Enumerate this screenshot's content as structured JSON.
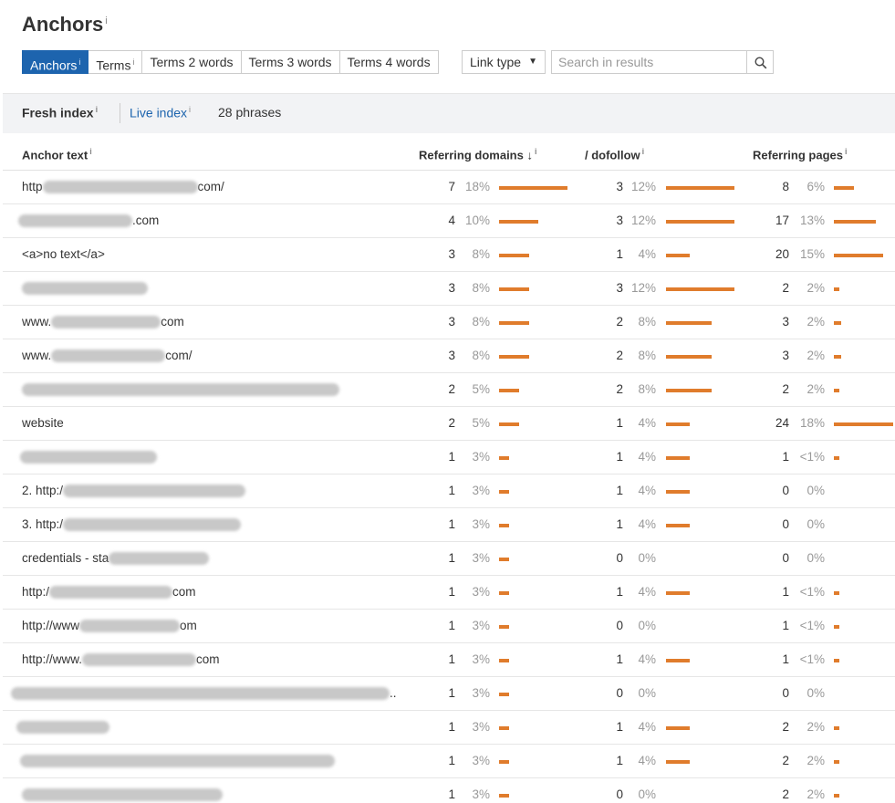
{
  "title": "Anchors",
  "info_glyph": "i",
  "tabs": [
    {
      "label": "Anchors",
      "active": true,
      "info": true
    },
    {
      "label": "Terms",
      "active": false,
      "info": true
    },
    {
      "label": "Terms 2 words",
      "active": false,
      "info": false
    },
    {
      "label": "Terms 3 words",
      "active": false,
      "info": false
    },
    {
      "label": "Terms 4 words",
      "active": false,
      "info": false
    }
  ],
  "link_type": {
    "label": "Link type",
    "caret": "▼"
  },
  "search": {
    "placeholder": "Search in results"
  },
  "index_bar": {
    "fresh": "Fresh index",
    "live": "Live index",
    "phrases": "28 phrases"
  },
  "columns": {
    "anchor": "Anchor text",
    "referring_domains": "Referring domains",
    "sort_arrow": "↓",
    "dofollow": "/ dofollow",
    "referring_pages": "Referring pages"
  },
  "colors": {
    "accent": "#1d64ae",
    "bar": "#e07c2c"
  },
  "rows": [
    {
      "pre": "http",
      "blur": 170,
      "post": "com/",
      "lead": 0,
      "rd": "7",
      "rdp": "18%",
      "rdb": 0.75,
      "df": "3",
      "dfp": "12%",
      "dfb": 0.75,
      "rp": "8",
      "rpp": "6%",
      "rpb": 0.22
    },
    {
      "pre": "",
      "blur": 125,
      "post": ".com",
      "lead": -4,
      "rd": "4",
      "rdp": "10%",
      "rdb": 0.43,
      "df": "3",
      "dfp": "12%",
      "dfb": 0.75,
      "rp": "17",
      "rpp": "13%",
      "rpb": 0.46
    },
    {
      "pre": "<a>no text</a>",
      "blur": 0,
      "post": "",
      "lead": 0,
      "rd": "3",
      "rdp": "8%",
      "rdb": 0.33,
      "df": "1",
      "dfp": "4%",
      "dfb": 0.26,
      "rp": "20",
      "rpp": "15%",
      "rpb": 0.54
    },
    {
      "pre": "",
      "blur": 138,
      "post": "",
      "lead": 0,
      "rd": "3",
      "rdp": "8%",
      "rdb": 0.33,
      "df": "3",
      "dfp": "12%",
      "dfb": 0.75,
      "rp": "2",
      "rpp": "2%",
      "rpb": 0.05
    },
    {
      "pre": "www.",
      "blur": 120,
      "post": "com",
      "lead": 0,
      "rd": "3",
      "rdp": "8%",
      "rdb": 0.33,
      "df": "2",
      "dfp": "8%",
      "dfb": 0.5,
      "rp": "3",
      "rpp": "2%",
      "rpb": 0.08
    },
    {
      "pre": "www.",
      "blur": 125,
      "post": "com/",
      "lead": 0,
      "rd": "3",
      "rdp": "8%",
      "rdb": 0.33,
      "df": "2",
      "dfp": "8%",
      "dfb": 0.5,
      "rp": "3",
      "rpp": "2%",
      "rpb": 0.08
    },
    {
      "pre": "",
      "blur": 348,
      "post": "",
      "lead": 0,
      "rd": "2",
      "rdp": "5%",
      "rdb": 0.22,
      "df": "2",
      "dfp": "8%",
      "dfb": 0.5,
      "rp": "2",
      "rpp": "2%",
      "rpb": 0.05
    },
    {
      "pre": "website",
      "blur": 0,
      "post": "",
      "lead": 0,
      "rd": "2",
      "rdp": "5%",
      "rdb": 0.22,
      "df": "1",
      "dfp": "4%",
      "dfb": 0.26,
      "rp": "24",
      "rpp": "18%",
      "rpb": 0.65
    },
    {
      "pre": "",
      "blur": 150,
      "post": "",
      "lead": -2,
      "rd": "1",
      "rdp": "3%",
      "rdb": 0.11,
      "df": "1",
      "dfp": "4%",
      "dfb": 0.26,
      "rp": "1",
      "rpp": "<1%",
      "rpb": 0.04
    },
    {
      "pre": "2. http:/",
      "blur": 200,
      "post": "",
      "lead": 0,
      "rd": "1",
      "rdp": "3%",
      "rdb": 0.11,
      "df": "1",
      "dfp": "4%",
      "dfb": 0.26,
      "rp": "0",
      "rpp": "0%",
      "rpb": 0
    },
    {
      "pre": "3. http:/",
      "blur": 195,
      "post": "",
      "lead": 0,
      "rd": "1",
      "rdp": "3%",
      "rdb": 0.11,
      "df": "1",
      "dfp": "4%",
      "dfb": 0.26,
      "rp": "0",
      "rpp": "0%",
      "rpb": 0
    },
    {
      "pre": "credentials - sta",
      "blur": 110,
      "post": "",
      "lead": 0,
      "rd": "1",
      "rdp": "3%",
      "rdb": 0.11,
      "df": "0",
      "dfp": "0%",
      "dfb": 0,
      "rp": "0",
      "rpp": "0%",
      "rpb": 0
    },
    {
      "pre": "http:/",
      "blur": 135,
      "post": "com",
      "lead": 0,
      "rd": "1",
      "rdp": "3%",
      "rdb": 0.11,
      "df": "1",
      "dfp": "4%",
      "dfb": 0.26,
      "rp": "1",
      "rpp": "<1%",
      "rpb": 0.04
    },
    {
      "pre": "http://www",
      "blur": 110,
      "post": "om",
      "lead": 0,
      "rd": "1",
      "rdp": "3%",
      "rdb": 0.11,
      "df": "0",
      "dfp": "0%",
      "dfb": 0,
      "rp": "1",
      "rpp": "<1%",
      "rpb": 0.04
    },
    {
      "pre": "http://www.",
      "blur": 125,
      "post": "com",
      "lead": 0,
      "rd": "1",
      "rdp": "3%",
      "rdb": 0.11,
      "df": "1",
      "dfp": "4%",
      "dfb": 0.26,
      "rp": "1",
      "rpp": "<1%",
      "rpb": 0.04
    },
    {
      "pre": "",
      "blur": 415,
      "post": "..",
      "lead": -12,
      "rd": "1",
      "rdp": "3%",
      "rdb": 0.11,
      "df": "0",
      "dfp": "0%",
      "dfb": 0,
      "rp": "0",
      "rpp": "0%",
      "rpb": 0
    },
    {
      "pre": "",
      "blur": 102,
      "post": "",
      "lead": -6,
      "rd": "1",
      "rdp": "3%",
      "rdb": 0.11,
      "df": "1",
      "dfp": "4%",
      "dfb": 0.26,
      "rp": "2",
      "rpp": "2%",
      "rpb": 0.05
    },
    {
      "pre": "",
      "blur": 345,
      "post": "",
      "lead": -2,
      "rd": "1",
      "rdp": "3%",
      "rdb": 0.11,
      "df": "1",
      "dfp": "4%",
      "dfb": 0.26,
      "rp": "2",
      "rpp": "2%",
      "rpb": 0.05
    },
    {
      "pre": "",
      "blur": 220,
      "post": "",
      "lead": 0,
      "rd": "1",
      "rdp": "3%",
      "rdb": 0.11,
      "df": "0",
      "dfp": "0%",
      "dfb": 0,
      "rp": "2",
      "rpp": "2%",
      "rpb": 0.05
    }
  ]
}
